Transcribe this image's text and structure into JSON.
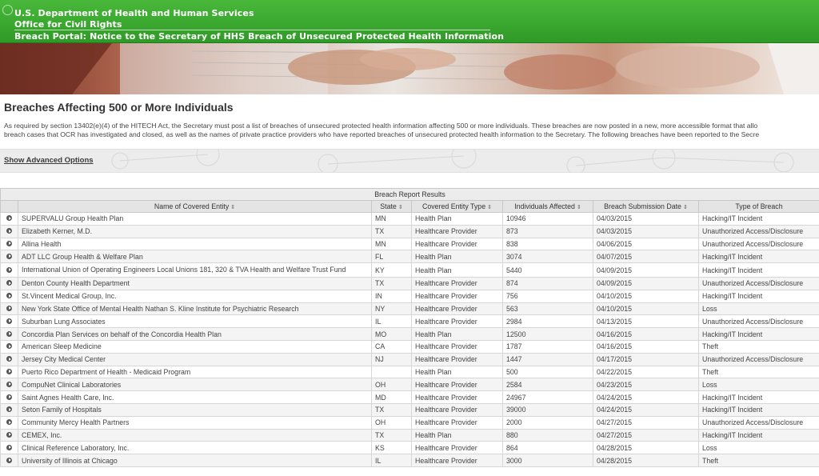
{
  "header": {
    "line1": "U.S. Department of Health and Human Services",
    "line2": "Office for Civil Rights",
    "line3": "Breach Portal: Notice to the Secretary of HHS Breach of Unsecured Protected Health Information"
  },
  "page": {
    "title": "Breaches Affecting 500 or More Individuals",
    "intro_line1": "As required by section 13402(e)(4) of the HITECH Act, the Secretary must post a list of breaches of unsecured protected health information affecting 500 or more individuals. These breaches are now posted in a new, more accessible format that allo",
    "intro_line2": "breach cases that OCR has investigated and closed, as well as the names of private practice providers who have reported breaches of unsecured protected health information to the Secretary. The following breaches have been reported to the Secre",
    "advanced_link": "Show Advanced Options"
  },
  "table": {
    "caption": "Breach Report Results",
    "sort_glyph": "⇕",
    "headers": {
      "entity": "Name of Covered Entity",
      "state": "State",
      "type": "Covered Entity Type",
      "affected": "Individuals Affected",
      "date": "Breach Submission Date",
      "breach": "Type of Breach"
    },
    "rows": [
      {
        "entity": "SUPERVALU Group Health Plan",
        "state": "MN",
        "type": "Health Plan",
        "affected": "10946",
        "date": "04/03/2015",
        "breach": "Hacking/IT Incident"
      },
      {
        "entity": "Elizabeth Kerner, M.D.",
        "state": "TX",
        "type": "Healthcare Provider",
        "affected": "873",
        "date": "04/03/2015",
        "breach": "Unauthorized Access/Disclosure"
      },
      {
        "entity": "Allina Health",
        "state": "MN",
        "type": "Healthcare Provider",
        "affected": "838",
        "date": "04/06/2015",
        "breach": "Unauthorized Access/Disclosure"
      },
      {
        "entity": "ADT LLC Group Health & Welfare Plan",
        "state": "FL",
        "type": "Health Plan",
        "affected": "3074",
        "date": "04/07/2015",
        "breach": "Hacking/IT Incident"
      },
      {
        "entity": "International Union of Operating Engineers Local Unions 181, 320 & TVA Health and Welfare Trust Fund",
        "state": "KY",
        "type": "Health Plan",
        "affected": "5440",
        "date": "04/09/2015",
        "breach": "Hacking/IT Incident"
      },
      {
        "entity": "Denton County Health Department",
        "state": "TX",
        "type": "Healthcare Provider",
        "affected": "874",
        "date": "04/09/2015",
        "breach": "Unauthorized Access/Disclosure"
      },
      {
        "entity": "St.Vincent Medical Group, Inc.",
        "state": "IN",
        "type": "Healthcare Provider",
        "affected": "756",
        "date": "04/10/2015",
        "breach": "Hacking/IT Incident"
      },
      {
        "entity": "New York State Office of Mental Health Nathan S. Kline Institute for Psychiatric Research",
        "state": "NY",
        "type": "Healthcare Provider",
        "affected": "563",
        "date": "04/10/2015",
        "breach": "Loss"
      },
      {
        "entity": "Suburban Lung Associates",
        "state": "IL",
        "type": "Healthcare Provider",
        "affected": "2984",
        "date": "04/13/2015",
        "breach": "Unauthorized Access/Disclosure"
      },
      {
        "entity": "Concordia Plan Services on behalf of the Concordia Health Plan",
        "state": "MO",
        "type": "Health Plan",
        "affected": "12500",
        "date": "04/16/2015",
        "breach": "Hacking/IT Incident"
      },
      {
        "entity": "American Sleep Medicine",
        "state": "CA",
        "type": "Healthcare Provider",
        "affected": "1787",
        "date": "04/16/2015",
        "breach": "Theft"
      },
      {
        "entity": "Jersey City Medical Center",
        "state": "NJ",
        "type": "Healthcare Provider",
        "affected": "1447",
        "date": "04/17/2015",
        "breach": "Unauthorized Access/Disclosure"
      },
      {
        "entity": "Puerto Rico Department of Health - Medicaid Program",
        "state": "",
        "type": "Health Plan",
        "affected": "500",
        "date": "04/22/2015",
        "breach": "Theft"
      },
      {
        "entity": "CompuNet Clinical Laboratories",
        "state": "OH",
        "type": "Healthcare Provider",
        "affected": "2584",
        "date": "04/23/2015",
        "breach": "Loss"
      },
      {
        "entity": "Saint Agnes Health Care, Inc.",
        "state": "MD",
        "type": "Healthcare Provider",
        "affected": "24967",
        "date": "04/24/2015",
        "breach": "Hacking/IT Incident"
      },
      {
        "entity": "Seton Family of Hospitals",
        "state": "TX",
        "type": "Healthcare Provider",
        "affected": "39000",
        "date": "04/24/2015",
        "breach": "Hacking/IT Incident"
      },
      {
        "entity": "Community Mercy Health Partners",
        "state": "OH",
        "type": "Healthcare Provider",
        "affected": "2000",
        "date": "04/27/2015",
        "breach": "Unauthorized Access/Disclosure"
      },
      {
        "entity": "CEMEX, Inc.",
        "state": "TX",
        "type": "Health Plan",
        "affected": "880",
        "date": "04/27/2015",
        "breach": "Hacking/IT Incident"
      },
      {
        "entity": "Clinical Reference Laboratory, Inc.",
        "state": "KS",
        "type": "Healthcare Provider",
        "affected": "864",
        "date": "04/28/2015",
        "breach": "Loss"
      },
      {
        "entity": "University of Illinois at Chicago",
        "state": "IL",
        "type": "Healthcare Provider",
        "affected": "3000",
        "date": "04/28/2015",
        "breach": "Theft"
      }
    ]
  }
}
